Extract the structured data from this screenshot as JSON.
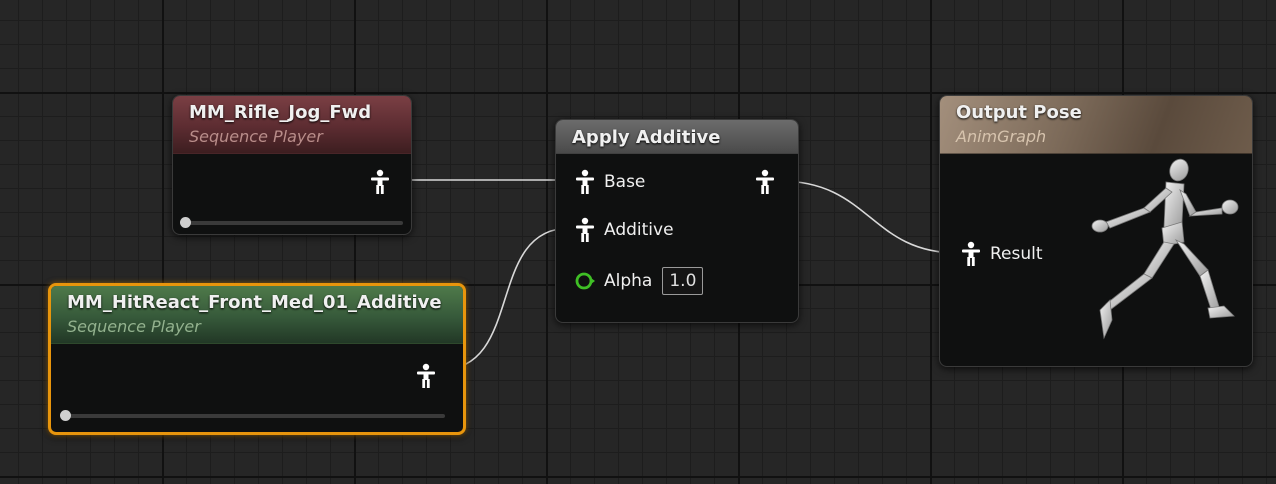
{
  "nodes": {
    "rifle": {
      "title": "MM_Rifle_Jog_Fwd",
      "subtitle": "Sequence Player",
      "header_color": "#6b363b",
      "playback_progress": 0.0
    },
    "hit_react": {
      "title": "MM_HitReact_Front_Med_01_Additive",
      "subtitle": "Sequence Player",
      "header_color": "#3f6a42",
      "selected": true,
      "selection_color": "#e8950c",
      "playback_progress": 0.0
    },
    "apply_additive": {
      "title": "Apply Additive",
      "header_color": "#5a5a5a",
      "pins": {
        "base": "Base",
        "additive": "Additive",
        "alpha": "Alpha",
        "alpha_value": "1.0"
      },
      "alpha_pin_color": "#3fbf25"
    },
    "output_pose": {
      "title": "Output Pose",
      "subtitle": "AnimGraph",
      "header_color": "#8c7866",
      "pins": {
        "result": "Result"
      }
    }
  },
  "icons": {
    "pose_pin": "pose-pin-icon",
    "float_pin": "float-pin-icon",
    "preview": "mannequin-preview-icon"
  },
  "colors": {
    "background": "#262626",
    "grid_major": "#111111",
    "grid_minor": "#1d1d1d",
    "wire": "#d8d8d8"
  }
}
